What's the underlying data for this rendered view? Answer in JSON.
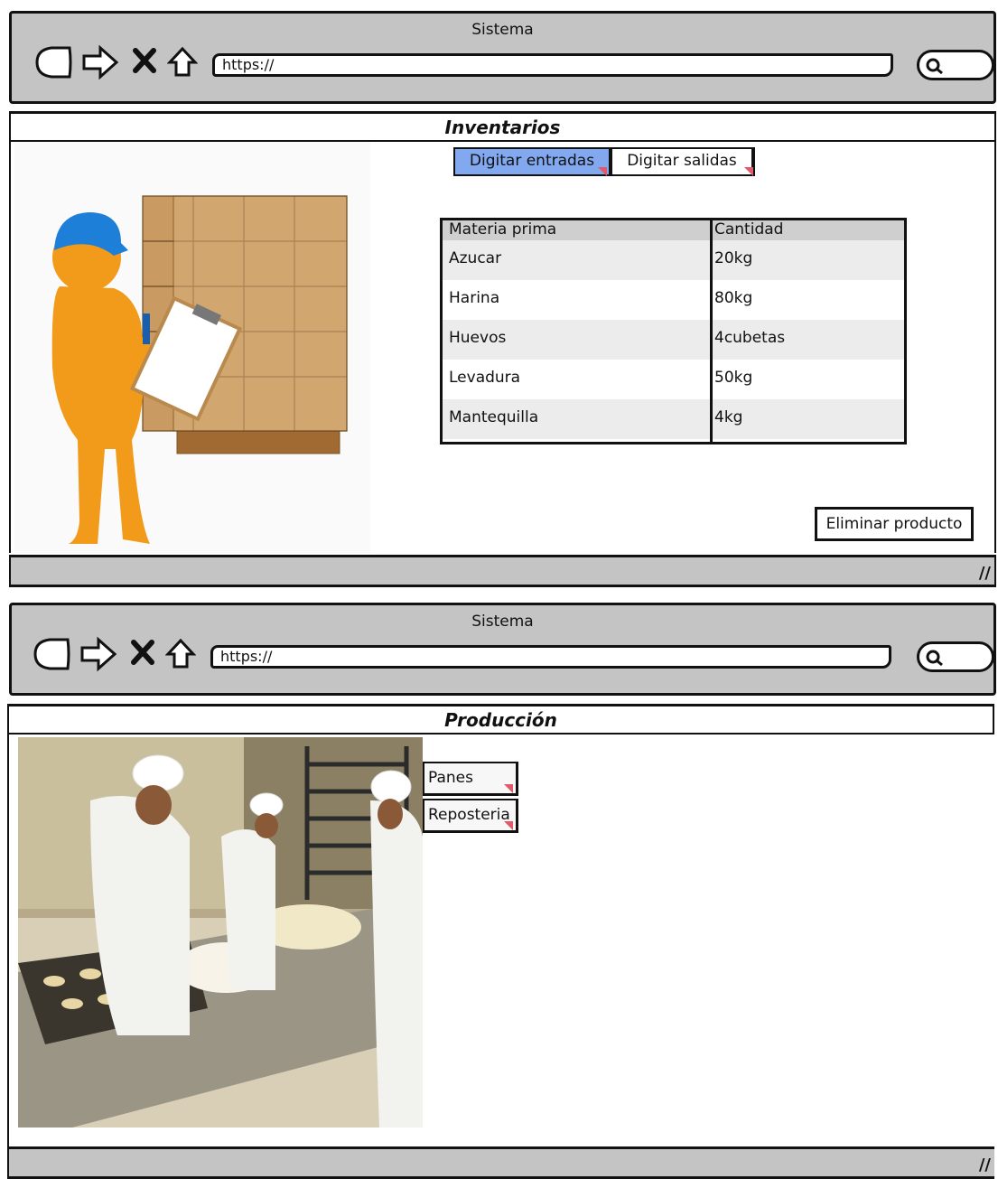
{
  "windows": [
    {
      "title": "Sistema",
      "url": "https://",
      "page_title": "Inventarios",
      "tabs": [
        {
          "label": "Digitar entradas",
          "selected": true
        },
        {
          "label": "Digitar salidas",
          "selected": false
        }
      ],
      "table": {
        "headers": [
          "Materia prima",
          "Cantidad"
        ],
        "rows": [
          [
            "Azucar",
            "20kg"
          ],
          [
            "Harina",
            "80kg"
          ],
          [
            "Huevos",
            "4cubetas"
          ],
          [
            "Levadura",
            "50kg"
          ],
          [
            "Mantequilla",
            "4kg"
          ]
        ]
      },
      "action_button": "Eliminar producto"
    },
    {
      "title": "Sistema",
      "url": "https://",
      "page_title": "Producción",
      "menu": [
        "Panes",
        "Reposteria"
      ]
    }
  ],
  "icons": [
    "back-arrow-icon",
    "forward-arrow-icon",
    "close-x-icon",
    "home-icon",
    "search-icon",
    "resize-grip-icon"
  ],
  "colors": {
    "chrome": "#c4c4c4",
    "selected_tab": "#82a8f0",
    "cursor_marker": "#e05a6a"
  }
}
